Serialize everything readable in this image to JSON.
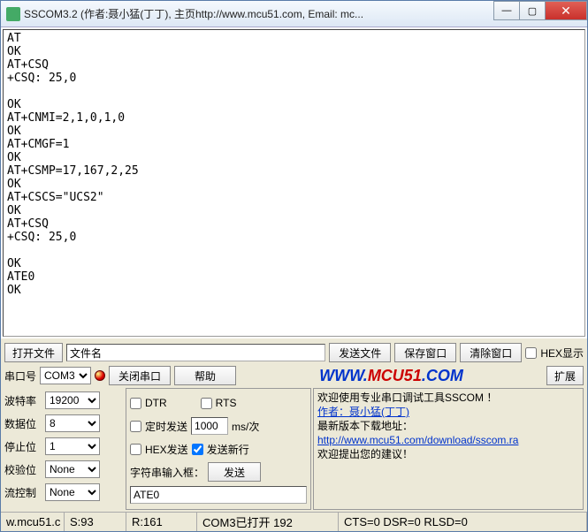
{
  "title": "SSCOM3.2 (作者:聂小猛(丁丁), 主页http://www.mcu51.com,  Email: mc...",
  "winbtns": {
    "min": "—",
    "max": "▢",
    "close": "✕"
  },
  "terminal": "AT\nOK\nAT+CSQ\n+CSQ: 25,0\n\nOK\nAT+CNMI=2,1,0,1,0\nOK\nAT+CMGF=1\nOK\nAT+CSMP=17,167,2,25\nOK\nAT+CSCS=\"UCS2\"\nOK\nAT+CSQ\n+CSQ: 25,0\n\nOK\nATE0\nOK",
  "row1": {
    "open_file": "打开文件",
    "filename": "文件名",
    "send_file": "发送文件",
    "save_window": "保存窗口",
    "clear_window": "清除窗口",
    "hex_display": "HEX显示"
  },
  "row2": {
    "port_label": "串口号",
    "port_value": "COM3",
    "close_port": "关闭串口",
    "help": "帮助",
    "mcu_www": "WWW.",
    "mcu_51": "MCU51",
    "mcu_com": ".COM",
    "expand": "扩展"
  },
  "settings": {
    "baud_label": "波特率",
    "baud_value": "19200",
    "databits_label": "数据位",
    "databits_value": "8",
    "stopbits_label": "停止位",
    "stopbits_value": "1",
    "parity_label": "校验位",
    "parity_value": "None",
    "flow_label": "流控制",
    "flow_value": "None"
  },
  "mid": {
    "dtr": "DTR",
    "rts": "RTS",
    "timed_send": "定时发送",
    "interval_value": "1000",
    "interval_unit": "ms/次",
    "hex_send": "HEX发送",
    "send_newline": "发送新行",
    "input_label": "字符串输入框：",
    "send_btn": "发送",
    "input_value": "ATE0"
  },
  "info": {
    "l1": "欢迎使用专业串口调试工具SSCOM ！",
    "l2": "作者：聂小猛(丁丁)",
    "l3": "最新版本下载地址：",
    "l4": "http://www.mcu51.com/download/sscom.ra",
    "l5": "欢迎提出您的建议！"
  },
  "status": {
    "url": "w.mcu51.c",
    "s": "S:93",
    "r": "R:161",
    "port": "COM3已打开  192",
    "lines": "CTS=0 DSR=0 RLSD=0"
  }
}
